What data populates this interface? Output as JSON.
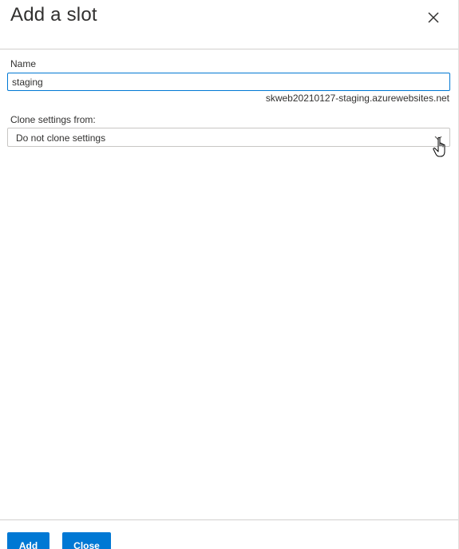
{
  "header": {
    "title": "Add a slot",
    "close_icon": "close-icon"
  },
  "form": {
    "name_label": "Name",
    "name_value": "staging",
    "hostname_hint": "skweb20210127-staging.azurewebsites.net",
    "clone_label": "Clone settings from:",
    "clone_selected": "Do not clone settings"
  },
  "footer": {
    "add_label": "Add",
    "close_label": "Close"
  },
  "colors": {
    "accent": "#0078d4",
    "text": "#323130",
    "border": "#c8c6c4"
  }
}
